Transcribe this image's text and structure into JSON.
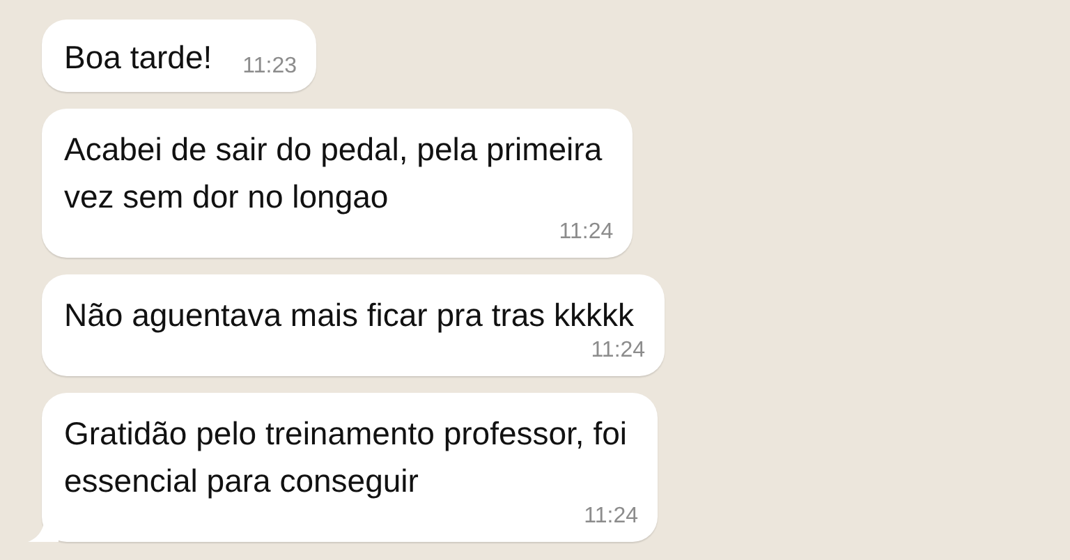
{
  "messages": [
    {
      "kind": "inline",
      "text": "Boa tarde!",
      "time": "11:23",
      "tail": false
    },
    {
      "kind": "stacked",
      "text": "Acabei de sair do pedal, pela primeira\nvez sem dor no longao",
      "time": "11:24",
      "tail": false
    },
    {
      "kind": "stacked",
      "text": "Não aguentava mais ficar pra tras kkkkk",
      "time": "11:24",
      "tail": false
    },
    {
      "kind": "stacked",
      "text": "Gratidão pelo treinamento professor, foi\nessencial para conseguir",
      "time": "11:24",
      "tail": true
    }
  ]
}
